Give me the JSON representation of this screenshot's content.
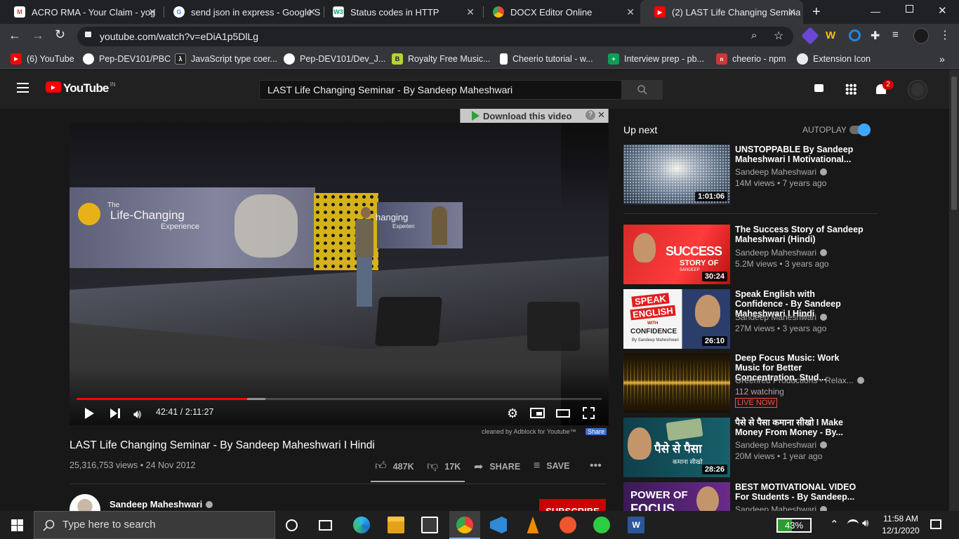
{
  "tabs": [
    {
      "title": "ACRO RMA - Your Claim - yog",
      "favicon": "gmail-icon"
    },
    {
      "title": "send json in express - Google S",
      "favicon": "google-icon"
    },
    {
      "title": "Status codes in HTTP",
      "favicon": "w3-icon"
    },
    {
      "title": "DOCX Editor Online",
      "favicon": "docx-icon"
    },
    {
      "title": "(2) LAST Life Changing Semina",
      "favicon": "youtube-icon"
    }
  ],
  "url": "youtube.com/watch?v=eDiA1p5DlLg",
  "bookmarks": [
    {
      "label": "(6) YouTube",
      "icon": "youtube-icon"
    },
    {
      "label": "Pep-DEV101/PBC",
      "icon": "github-icon"
    },
    {
      "label": "JavaScript type coer...",
      "icon": "lambda-icon"
    },
    {
      "label": "Pep-DEV101/Dev_J...",
      "icon": "github-icon"
    },
    {
      "label": "Royalty Free Music...",
      "icon": "b-icon"
    },
    {
      "label": "Cheerio tutorial - w...",
      "icon": "page-icon"
    },
    {
      "label": "Interview prep - pb...",
      "icon": "plus-icon"
    },
    {
      "label": "cheerio - npm",
      "icon": "npm-icon"
    },
    {
      "label": "Extension Icon",
      "icon": "globe-icon"
    }
  ],
  "yt": {
    "logo": "YouTube",
    "region": "IN",
    "search_query": "LAST Life Changing Seminar - By Sandeep Maheshwari",
    "notification_count": "2"
  },
  "player": {
    "download_label": "Download this video",
    "time": "42:41 / 2:11:27",
    "progress": 0.325,
    "cleaned_note": "cleaned by Adblock for Youtube™",
    "share_badge": "Share",
    "stage_text_1": "The",
    "stage_text_2": "Life-Changing",
    "stage_text_3": "Experience",
    "stage_text_4": "hanging",
    "stage_text_5": "Experien"
  },
  "video": {
    "title": "LAST Life Changing Seminar - By Sandeep Maheshwari I Hindi",
    "views_date": "25,316,753 views • 24 Nov 2012",
    "likes": "487K",
    "dislikes": "17K",
    "share": "SHARE",
    "save": "SAVE",
    "channel": "Sandeep Maheshwari",
    "subscribe": "SUBSCRIBE"
  },
  "upnext": {
    "heading": "Up next",
    "autoplay": "AUTOPLAY",
    "items": [
      {
        "title": "UNSTOPPABLE By Sandeep Maheshwari I Motivational...",
        "channel": "Sandeep Maheshwari",
        "meta": "14M views • 7 years ago",
        "duration": "1:01:06"
      },
      {
        "title": "The Success Story of Sandeep Maheshwari (Hindi)",
        "channel": "Sandeep Maheshwari",
        "meta": "5.2M views • 3 years ago",
        "duration": "30:24",
        "thumb_text_1": "SUCCESS",
        "thumb_text_2": "STORY OF",
        "thumb_text_3": "SANDEEP"
      },
      {
        "title": "Speak English with Confidence - By Sandeep Maheshwari I Hindi",
        "channel": "Sandeep Maheshwari",
        "meta": "27M views • 3 years ago",
        "duration": "26:10",
        "thumb_text_1": "SPEAK",
        "thumb_text_2": "ENGLISH",
        "thumb_text_3": "WITH",
        "thumb_text_4": "CONFIDENCE",
        "thumb_text_5": "By Sandeep Maheshwari"
      },
      {
        "title": "Deep Focus Music: Work Music for Better Concentration, Stud...",
        "channel": "Greenred Productions - Relax...",
        "meta": "112 watching",
        "badge": "LIVE NOW"
      },
      {
        "title": "पैसे से पैसा कमाना सीखो I Make Money From Money - By...",
        "channel": "Sandeep Maheshwari",
        "meta": "20M views • 1 year ago",
        "duration": "28:26",
        "thumb_text_1": "पैसे से पैसा",
        "thumb_text_2": "कमाना सीखो"
      },
      {
        "title": "BEST MOTIVATIONAL VIDEO For Students - By Sandeep...",
        "channel": "Sandeep Maheshwari",
        "thumb_text_1": "POWER OF",
        "thumb_text_2": "FOCUS"
      }
    ]
  },
  "taskbar": {
    "search_placeholder": "Type here to search",
    "battery": "43%",
    "time": "11:58 AM",
    "date": "12/1/2020"
  },
  "colors": {
    "accent_red": "#ff0000",
    "autoplay_blue": "#3ea6ff",
    "bg": "#181818"
  }
}
